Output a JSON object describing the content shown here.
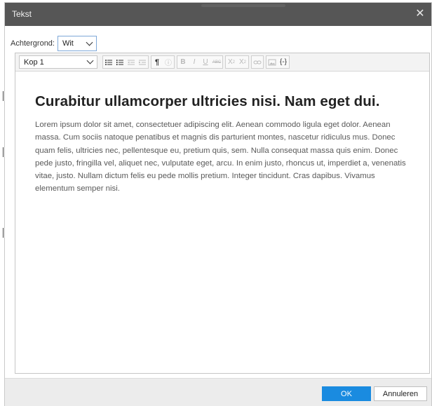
{
  "dialog": {
    "title": "Tekst",
    "close_icon": "close-icon"
  },
  "background": {
    "label": "Achtergrond:",
    "value": "Wit"
  },
  "toolbar": {
    "format_value": "Kop 1",
    "buttons": [
      {
        "name": "bullet-list",
        "enabled": true
      },
      {
        "name": "numbered-list",
        "enabled": true
      },
      {
        "name": "outdent",
        "enabled": false
      },
      {
        "name": "indent",
        "enabled": false
      },
      {
        "name": "paragraph",
        "enabled": true
      },
      {
        "name": "info",
        "enabled": false
      },
      {
        "name": "bold",
        "enabled": false
      },
      {
        "name": "italic",
        "enabled": false
      },
      {
        "name": "underline",
        "enabled": false
      },
      {
        "name": "strikethrough",
        "enabled": false
      },
      {
        "name": "subscript",
        "enabled": false
      },
      {
        "name": "superscript",
        "enabled": false
      },
      {
        "name": "link",
        "enabled": false
      },
      {
        "name": "image",
        "enabled": false
      },
      {
        "name": "code",
        "enabled": true
      }
    ]
  },
  "content": {
    "heading": "Curabitur ullamcorper ultricies nisi. Nam eget dui.",
    "body": "Lorem ipsum dolor sit amet, consectetuer adipiscing elit. Aenean commodo ligula eget dolor. Aenean massa. Cum sociis natoque penatibus et magnis dis parturient montes, nascetur ridiculus mus. Donec quam felis, ultricies nec, pellentesque eu, pretium quis, sem. Nulla consequat massa quis enim. Donec pede justo, fringilla vel, aliquet nec, vulputate eget, arcu. In enim justo, rhoncus ut, imperdiet a, venenatis vitae, justo. Nullam dictum felis eu pede mollis pretium. Integer tincidunt. Cras dapibus. Vivamus elementum semper nisi."
  },
  "footer": {
    "ok_label": "OK",
    "cancel_label": "Annuleren"
  },
  "colors": {
    "titlebar": "#565656",
    "ok_button": "#1a8be0",
    "footer": "#ececec"
  }
}
